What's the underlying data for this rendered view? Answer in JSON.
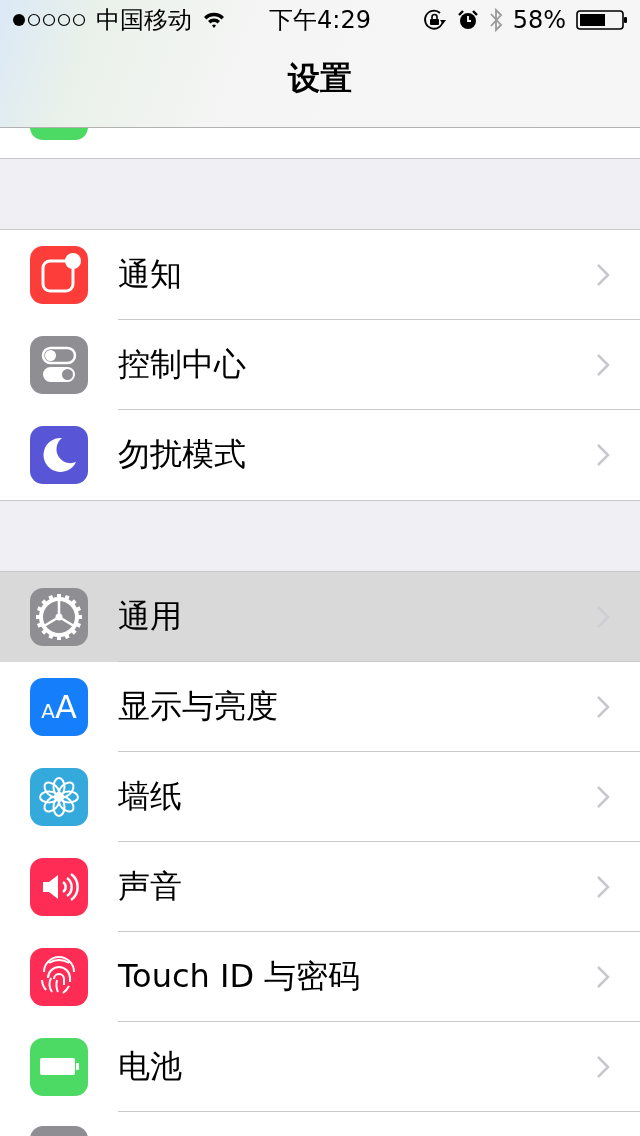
{
  "status_bar": {
    "carrier": "中国移动",
    "time": "下午4:29",
    "battery_percent": "58%"
  },
  "nav_bar": {
    "title": "设置"
  },
  "sections": [
    {
      "rows": [
        {
          "kind": "partial-green",
          "selected": false
        }
      ]
    },
    {
      "rows": [
        {
          "kind": "notifications",
          "label": "通知",
          "selected": false
        },
        {
          "kind": "control-center",
          "label": "控制中心",
          "selected": false
        },
        {
          "kind": "do-not-disturb",
          "label": "勿扰模式",
          "selected": false
        }
      ]
    },
    {
      "rows": [
        {
          "kind": "general",
          "label": "通用",
          "selected": true
        },
        {
          "kind": "display",
          "label": "显示与亮度",
          "icon_text": "AA",
          "selected": false
        },
        {
          "kind": "wallpaper",
          "label": "墙纸",
          "selected": false
        },
        {
          "kind": "sounds",
          "label": "声音",
          "selected": false
        },
        {
          "kind": "touch-id",
          "label": "Touch ID 与密码",
          "selected": false
        },
        {
          "kind": "battery",
          "label": "电池",
          "selected": false
        },
        {
          "kind": "partial-grey",
          "selected": false
        }
      ]
    }
  ]
}
